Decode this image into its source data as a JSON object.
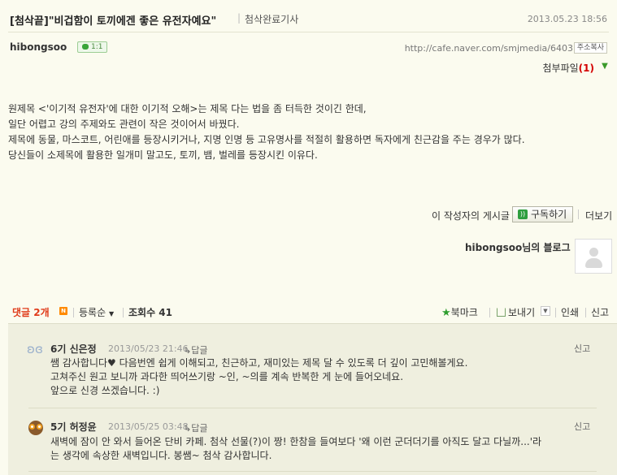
{
  "post": {
    "title": "[첨삭끝]\"비겁함이 토끼에겐 좋은 유전자예요\"",
    "title_sep": "|",
    "category": "첨삭완료기사",
    "date": "2013.05.23 18:56",
    "author": "hibongsoo",
    "comment_badge": "1:1",
    "url": "http://cafe.naver.com/smjmedia/6403",
    "copy_address": "주소복사",
    "attachment_label": "첨부파일",
    "attachment_count": "(1)",
    "body": [
      "원제목 <'이기적 유전자'에 대한 이기적 오해>는 제목 다는 법을 좀 터득한 것이긴 한데,",
      "일단 어렵고 강의 주제와도 관련이 작은 것이어서 바꿨다.",
      "제목에 동물, 마스코트, 어린애를 등장시키거나, 지명 인명 등 고유명사를 적절히 활용하면 독자에게 친근감을 주는 경우가 많다.",
      "당신들이 소제목에 활용한 일개미 말고도, 토끼, 뱀, 벌레를 등장시킨 이유다."
    ]
  },
  "author_box": {
    "posts_label": "이 작성자의 게시글",
    "subscribe_label": "구독하기",
    "more_label": "더보기",
    "blog_name": "hibongsoo님의 블로그"
  },
  "toolbar": {
    "comments_label": "댓글 2개",
    "new_badge": "N",
    "sort_label": "등록순",
    "views_label": "조회수 41",
    "bookmark_label": "북마크",
    "send_label": "보내기",
    "print_label": "인쇄",
    "report_label": "신고"
  },
  "comments": [
    {
      "name": "6기 신은정",
      "date": "2013/05/23 21:46",
      "reply": "답글",
      "report": "신고",
      "lines": [
        "쌤 감사합니다♥ 다음번엔 쉽게 이해되고, 친근하고, 재미있는 제목 달 수 있도록 더 깊이 고민해볼게요.",
        "고쳐주신 원고 보니까 과다한 띄어쓰기랑 ~인, ~의를 계속 반복한 게 눈에 들어오네요.",
        "앞으로 신경 쓰겠습니다. :)"
      ]
    },
    {
      "name": "5기 허정윤",
      "date": "2013/05/25 03:48",
      "reply": "답글",
      "report": "신고",
      "lines": [
        "새벽에 잠이 안 와서 들어온 단비 카페. 첨삭 선물(?)이 짱! 한참을 들여보다 '왜 이런 군더더기를 아직도 달고 다닐까...'라",
        "는 생각에 속상한 새벽입니다. 봉쌤~ 첨삭 감사합니다."
      ]
    }
  ]
}
